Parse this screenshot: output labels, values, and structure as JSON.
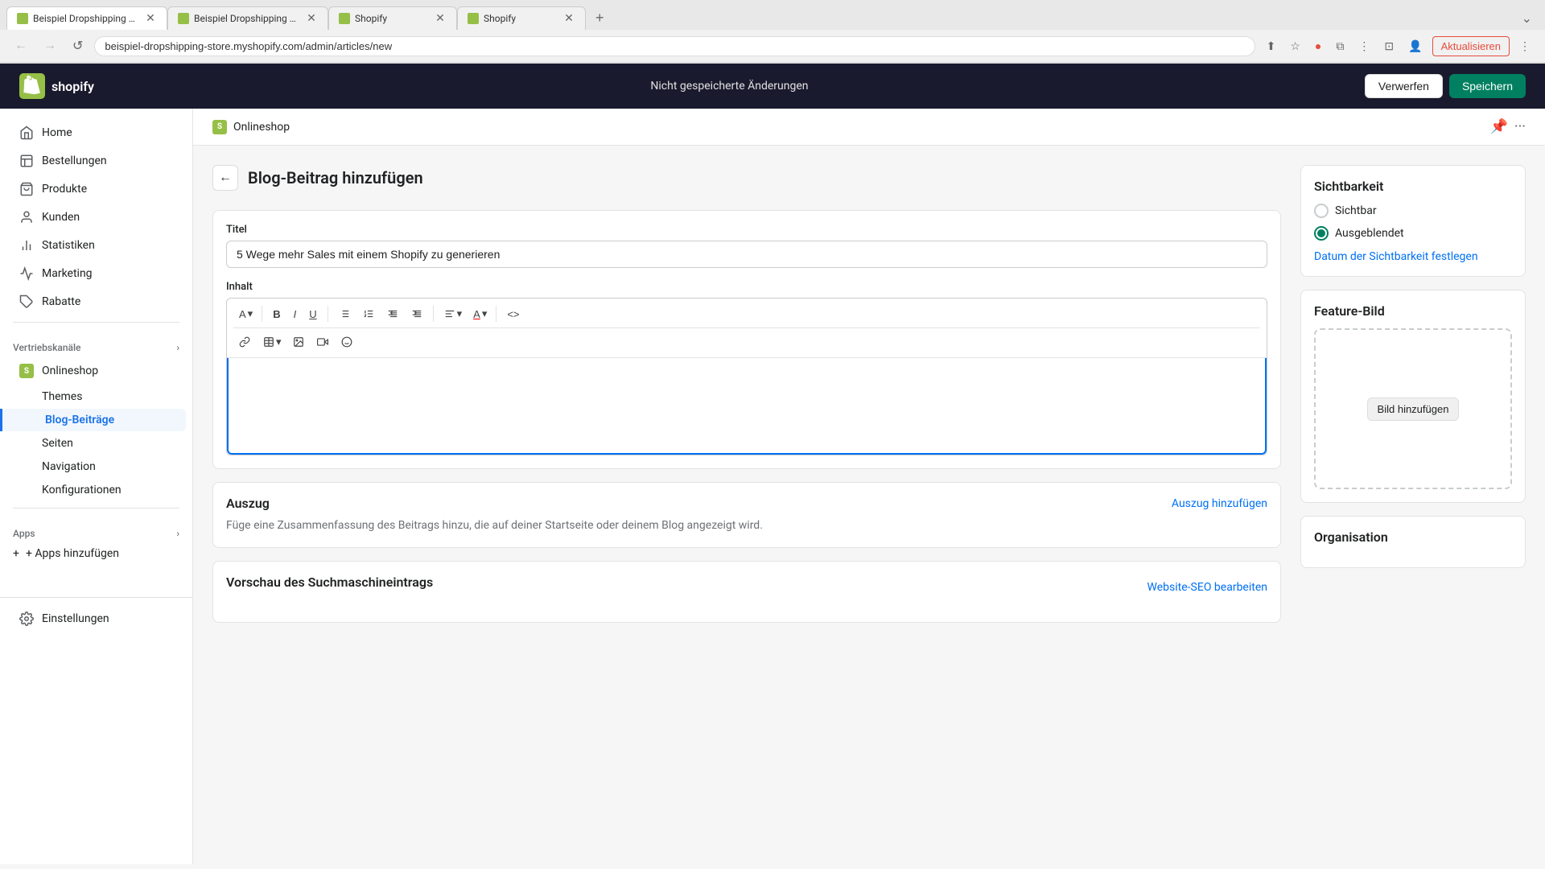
{
  "browser": {
    "tabs": [
      {
        "id": "tab1",
        "title": "Beispiel Dropshipping Store ·...",
        "active": true,
        "favicon_color": "#95bf47"
      },
      {
        "id": "tab2",
        "title": "Beispiel Dropshipping Store",
        "active": false,
        "favicon_color": "#95bf47"
      },
      {
        "id": "tab3",
        "title": "Shopify",
        "active": false,
        "favicon_color": "#95bf47"
      },
      {
        "id": "tab4",
        "title": "Shopify",
        "active": false,
        "favicon_color": "#95bf47"
      }
    ],
    "address": "beispiel-dropshipping-store.myshopify.com/admin/articles/new",
    "update_label": "Aktualisieren"
  },
  "header": {
    "logo_text": "shopify",
    "unsaved_label": "Nicht gespeicherte Änderungen",
    "discard_label": "Verwerfen",
    "save_label": "Speichern"
  },
  "sidebar": {
    "store_label": "Onlineshop",
    "items": [
      {
        "id": "home",
        "label": "Home",
        "icon": "🏠"
      },
      {
        "id": "orders",
        "label": "Bestellungen",
        "icon": "📋"
      },
      {
        "id": "products",
        "label": "Produkte",
        "icon": "🛍️"
      },
      {
        "id": "customers",
        "label": "Kunden",
        "icon": "👤"
      },
      {
        "id": "analytics",
        "label": "Statistiken",
        "icon": "📊"
      },
      {
        "id": "marketing",
        "label": "Marketing",
        "icon": "📣"
      },
      {
        "id": "discounts",
        "label": "Rabatte",
        "icon": "🏷️"
      }
    ],
    "sales_channels_label": "Vertriebskanäle",
    "online_store_label": "Onlineshop",
    "sub_items": [
      {
        "id": "themes",
        "label": "Themes"
      },
      {
        "id": "blog-posts",
        "label": "Blog-Beiträge",
        "active": true
      },
      {
        "id": "pages",
        "label": "Seiten"
      },
      {
        "id": "navigation",
        "label": "Navigation"
      },
      {
        "id": "configurations",
        "label": "Konfigurationen"
      }
    ],
    "apps_label": "Apps",
    "add_apps_label": "+ Apps hinzufügen",
    "settings_label": "Einstellungen"
  },
  "content": {
    "breadcrumb_label": "Onlineshop",
    "page_title": "Blog-Beitrag hinzufügen",
    "title_label": "Titel",
    "title_value": "5 Wege mehr Sales mit einem Shopify zu generieren",
    "content_label": "Inhalt",
    "editor_toolbar": {
      "text_btn": "A",
      "bold_btn": "B",
      "italic_btn": "I",
      "underline_btn": "U",
      "list_ul_btn": "≡",
      "list_center_btn": "≡",
      "indent_left_btn": "←",
      "indent_right_btn": "→",
      "align_btn": "≡",
      "color_btn": "A",
      "link_btn": "🔗",
      "table_btn": "▦",
      "image_btn": "🖼",
      "video_btn": "▶",
      "emoji_btn": "☺",
      "code_btn": "<>"
    }
  },
  "auszug": {
    "title": "Auszug",
    "add_link": "Auszug hinzufügen",
    "description": "Füge eine Zusammenfassung des Beitrags hinzu, die auf deiner Startseite oder deinem Blog angezeigt wird."
  },
  "vorschau": {
    "title": "Vorschau des Suchmaschineintrags",
    "edit_link": "Website-SEO bearbeiten"
  },
  "sichtbarkeit": {
    "title": "Sichtbarkeit",
    "sichtbar_label": "Sichtbar",
    "ausgeblendet_label": "Ausgeblendet",
    "datum_label": "Datum der Sichtbarkeit festlegen",
    "sichtbar_checked": false,
    "ausgeblendet_checked": true
  },
  "feature_bild": {
    "title": "Feature-Bild",
    "add_btn": "Bild hinzufügen"
  },
  "organisation": {
    "title": "Organisation"
  }
}
